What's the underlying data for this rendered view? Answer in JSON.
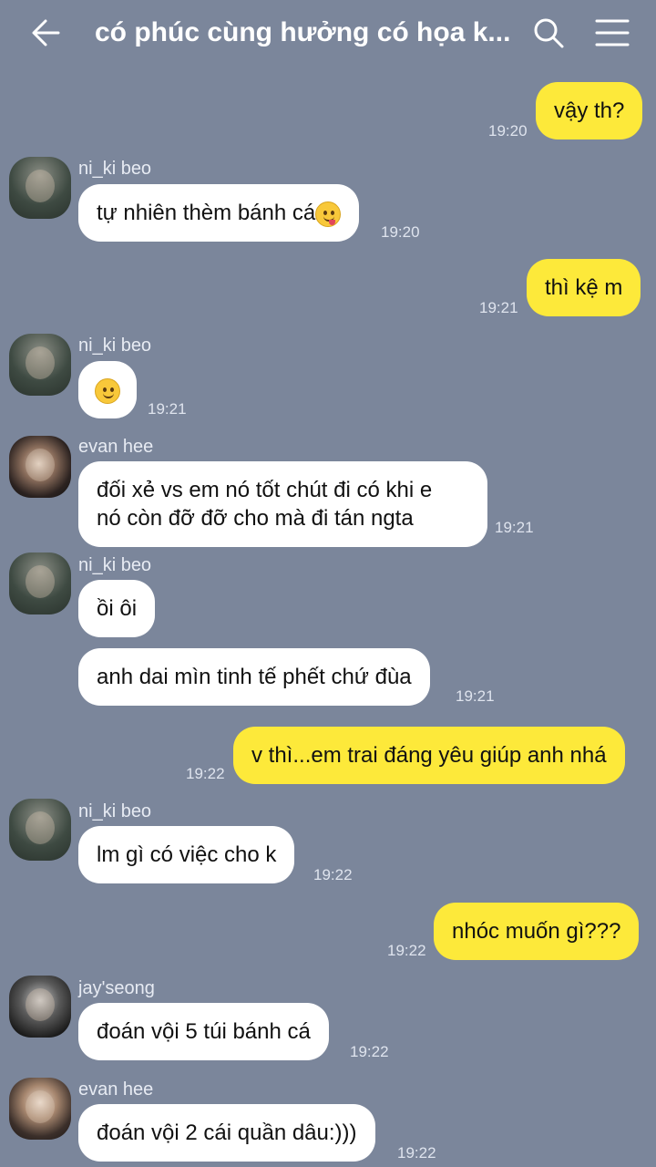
{
  "header": {
    "title": "có phúc cùng hưởng có họa k...",
    "back_icon": "back-arrow-icon",
    "search_icon": "search-icon",
    "menu_icon": "menu-icon"
  },
  "colors": {
    "background": "#7b869b",
    "incoming_bubble": "#ffffff",
    "outgoing_bubble": "#fde93a"
  },
  "messages": [
    {
      "dir": "out",
      "text": "vậy th?",
      "time": "19:20"
    },
    {
      "dir": "in",
      "sender": "ni_ki beo",
      "text": "tự nhiên thèm bánh cá",
      "emoji": "yum-emoji",
      "time": "19:20"
    },
    {
      "dir": "out",
      "text": "thì kệ m",
      "time": "19:21"
    },
    {
      "dir": "in",
      "sender": "ni_ki beo",
      "emoji": "slight-smile-emoji",
      "time": "19:21"
    },
    {
      "dir": "in",
      "sender": "evan hee",
      "text_lines": [
        "đối xẻ vs em nó tốt chút đi có khi e",
        "nó còn đỡ đỡ cho mà đi tán ngta"
      ],
      "time": "19:21"
    },
    {
      "dir": "in",
      "sender": "ni_ki beo",
      "text": "ồi ôi"
    },
    {
      "dir": "in",
      "text": "anh dai mìn tinh tế phết chứ đùa",
      "time": "19:21"
    },
    {
      "dir": "out",
      "text": "v thì...em trai đáng yêu giúp anh nhá",
      "time": "19:22"
    },
    {
      "dir": "in",
      "sender": "ni_ki beo",
      "text": "lm gì có việc cho k",
      "time": "19:22"
    },
    {
      "dir": "out",
      "text": "nhóc muốn gì???",
      "time": "19:22"
    },
    {
      "dir": "in",
      "sender": "jay'seong",
      "text": "đoán vội 5 túi bánh cá",
      "time": "19:22"
    },
    {
      "dir": "in",
      "sender": "evan hee",
      "text": "đoán vội 2 cái quần dâu:)))",
      "time": "19:22"
    }
  ]
}
